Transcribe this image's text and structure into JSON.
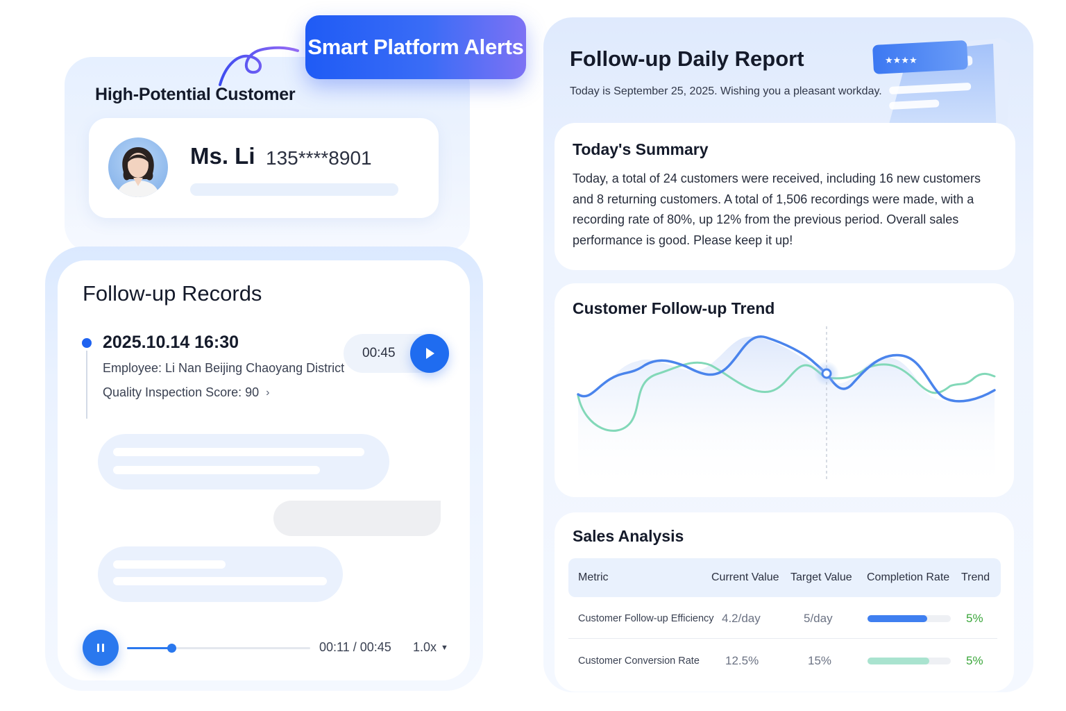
{
  "alerts_pill": {
    "label": "Smart Platform Alerts"
  },
  "customer": {
    "section_title": "High-Potential Customer",
    "name": "Ms. Li",
    "phone": "135****8901"
  },
  "records": {
    "title": "Follow-up Records",
    "entry": {
      "datetime": "2025.10.14 16:30",
      "employee": "Employee: Li Nan  Beijing Chaoyang District",
      "score": "Quality Inspection Score: 90",
      "audio_duration": "00:45"
    },
    "player": {
      "time": "00:11 / 00:45",
      "speed": "1.0x",
      "progress_fraction": 0.244
    }
  },
  "report": {
    "title": "Follow-up Daily Report",
    "subtitle": "Today is September 25, 2025. Wishing you a pleasant workday.",
    "summary": {
      "title": "Today's Summary",
      "text": "Today, a total of 24 customers were received, including 16 new customers and 8 returning customers. A total of 1,506 recordings were made, with a recording rate of 80%, up 12% from the previous period. Overall sales performance is good. Please keep it up!"
    },
    "trend": {
      "title": "Customer Follow-up Trend"
    },
    "sales": {
      "title": "Sales Analysis",
      "headers": [
        "Metric",
        "Current Value",
        "Target Value",
        "Completion Rate",
        "Trend"
      ],
      "rows": [
        {
          "metric": "Customer Follow-up Efficiency",
          "current": "4.2/day",
          "target": "5/day",
          "completion": 0.72,
          "trend": "5%",
          "bar_color": "#3f7ff0"
        },
        {
          "metric": "Customer Conversion Rate",
          "current": "12.5%",
          "target": "15%",
          "completion": 0.74,
          "trend": "5%",
          "bar_color": "#a9e3cf"
        }
      ]
    }
  },
  "colors": {
    "accent": "#1f63f0",
    "trend_blue": "#4a84ec",
    "trend_green": "#7fd6b4",
    "positive": "#3aa63a"
  }
}
